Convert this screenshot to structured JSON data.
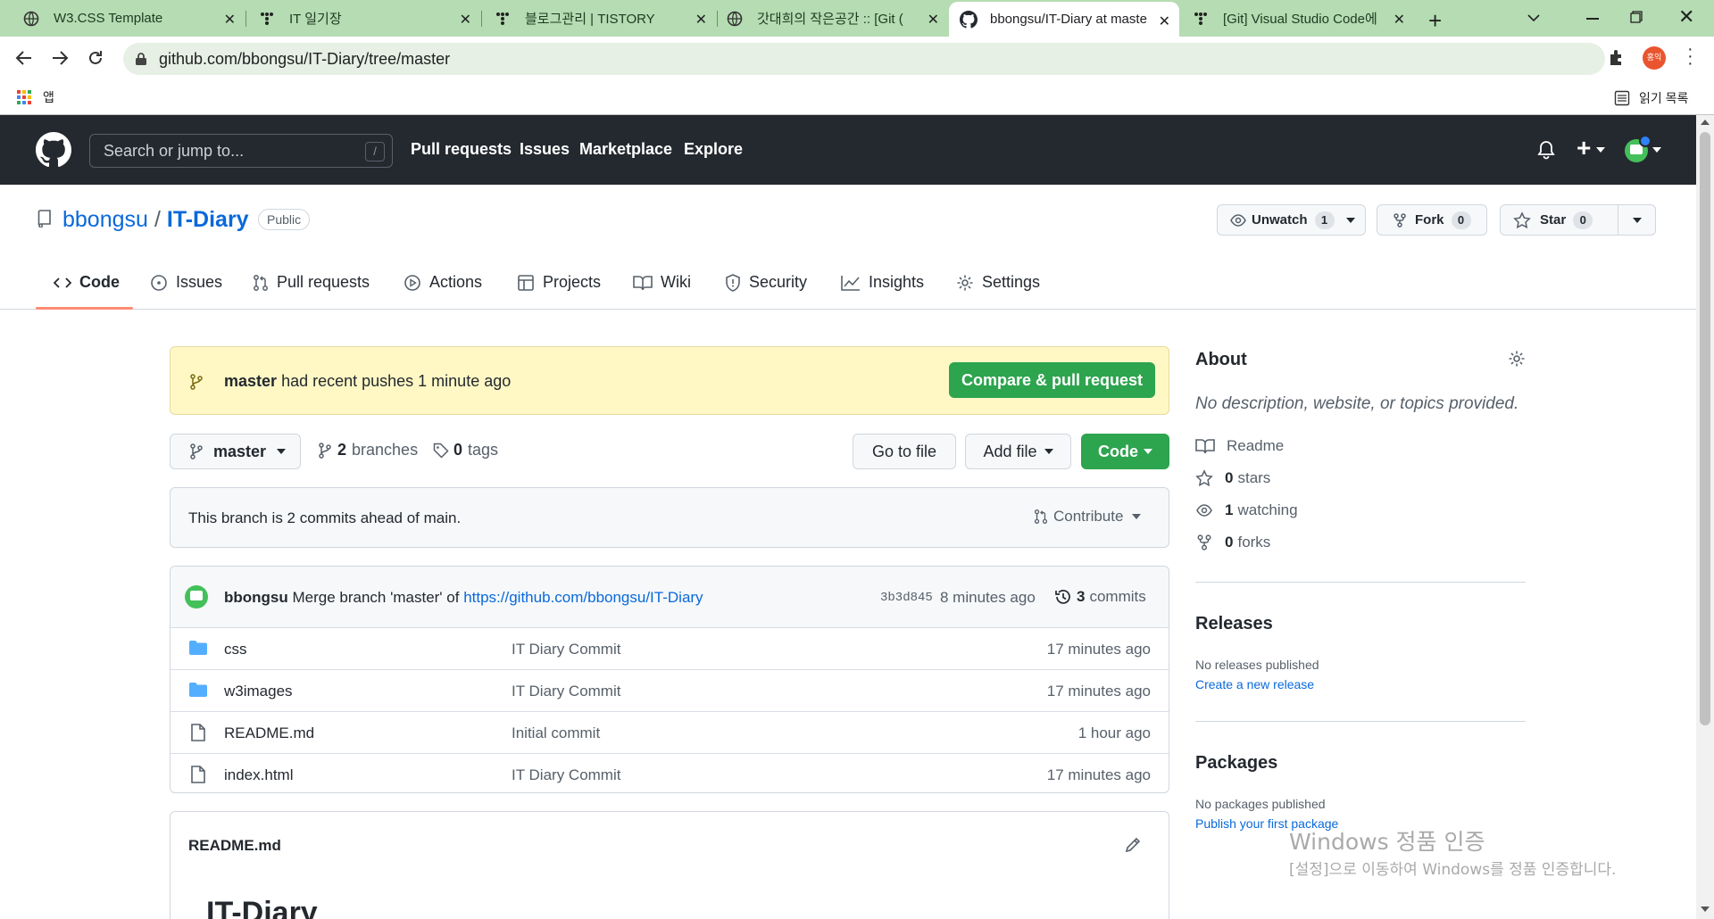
{
  "browser": {
    "tabs": [
      {
        "title": "W3.CSS Template",
        "icon": "globe-icon",
        "active": false
      },
      {
        "title": "IT 일기장",
        "icon": "tistory-icon",
        "active": false
      },
      {
        "title": "블로그관리 | TISTORY",
        "icon": "tistory-icon",
        "active": false
      },
      {
        "title": "갓대희의 작은공간 :: [Git (",
        "icon": "globe-icon",
        "active": false
      },
      {
        "title": "bbongsu/IT-Diary at maste",
        "icon": "github-icon",
        "active": true
      },
      {
        "title": "[Git] Visual Studio Code에",
        "icon": "tistory-icon",
        "active": false
      }
    ],
    "url": "github.com/bbongsu/IT-Diary/tree/master",
    "profile_badge": "홍익",
    "bookmarks": {
      "apps_label": "앱",
      "reading_list": "읽기 목록"
    }
  },
  "github": {
    "search_placeholder": "Search or jump to...",
    "search_key": "/",
    "nav": [
      "Pull requests",
      "Issues",
      "Marketplace",
      "Explore"
    ]
  },
  "repo": {
    "owner": "bbongsu",
    "separator": "/",
    "name": "IT-Diary",
    "visibility": "Public",
    "unwatch_label": "Unwatch",
    "watch_count": "1",
    "fork_label": "Fork",
    "fork_count": "0",
    "star_label": "Star",
    "star_count": "0",
    "tabs": [
      {
        "label": "Code",
        "icon": "code-icon"
      },
      {
        "label": "Issues",
        "icon": "issue-icon"
      },
      {
        "label": "Pull requests",
        "icon": "pull-request-icon"
      },
      {
        "label": "Actions",
        "icon": "play-icon"
      },
      {
        "label": "Projects",
        "icon": "table-icon"
      },
      {
        "label": "Wiki",
        "icon": "book-icon"
      },
      {
        "label": "Security",
        "icon": "shield-icon"
      },
      {
        "label": "Insights",
        "icon": "graph-icon"
      },
      {
        "label": "Settings",
        "icon": "gear-icon"
      }
    ]
  },
  "banner": {
    "branch": "master",
    "text": "had recent pushes 1 minute ago",
    "button": "Compare & pull request"
  },
  "branch_bar": {
    "branch": "master",
    "branches_count": "2",
    "branches_label": "branches",
    "tags_count": "0",
    "tags_label": "tags",
    "go_to_file": "Go to file",
    "add_file": "Add file",
    "code": "Code"
  },
  "ahead": {
    "text": "This branch is 2 commits ahead of main.",
    "contribute": "Contribute"
  },
  "commit": {
    "author": "bbongsu",
    "message": "Merge branch 'master' of",
    "link": "https://github.com/bbongsu/IT-Diary",
    "sha": "3b3d845",
    "time": "8 minutes ago",
    "commits_count": "3",
    "commits_label": "commits"
  },
  "files": [
    {
      "name": "css",
      "type": "folder",
      "message": "IT Diary Commit",
      "time": "17 minutes ago"
    },
    {
      "name": "w3images",
      "type": "folder",
      "message": "IT Diary Commit",
      "time": "17 minutes ago"
    },
    {
      "name": "README.md",
      "type": "file",
      "message": "Initial commit",
      "time": "1 hour ago"
    },
    {
      "name": "index.html",
      "type": "file",
      "message": "IT Diary Commit",
      "time": "17 minutes ago"
    }
  ],
  "readme": {
    "filename": "README.md",
    "heading": "IT-Diary"
  },
  "sidebar": {
    "about_title": "About",
    "about_desc": "No description, website, or topics provided.",
    "readme": "Readme",
    "stars_count": "0",
    "stars_label": "stars",
    "watching_count": "1",
    "watching_label": "watching",
    "forks_count": "0",
    "forks_label": "forks",
    "releases_title": "Releases",
    "releases_none": "No releases published",
    "releases_link": "Create a new release",
    "packages_title": "Packages",
    "packages_none": "No packages published",
    "packages_link": "Publish your first package"
  },
  "watermark": {
    "line1": "Windows 정품 인증",
    "line2": "[설정]으로 이동하여 Windows를 정품 인증합니다."
  },
  "colors": {
    "tabstrip": "#b5dcb2",
    "gh_header": "#24292f",
    "link": "#0969da",
    "green_button": "#2da44e",
    "banner_bg": "#fff8c5",
    "folder": "#54aeff",
    "active_tab_underline": "#fd8c73"
  }
}
